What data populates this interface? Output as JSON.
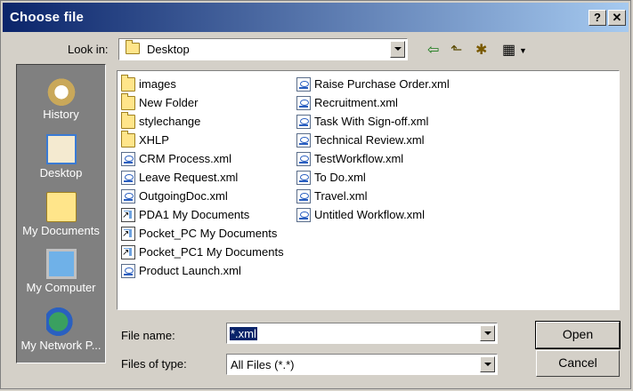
{
  "window": {
    "title": "Choose file",
    "help_label": "?",
    "close_label": "✕"
  },
  "look_in": {
    "label": "Look in:",
    "value": "Desktop"
  },
  "toolbar": {
    "back_glyph": "⇦",
    "up_glyph": "⬑",
    "newfolder_glyph": "✱",
    "view_glyph": "▦"
  },
  "places": [
    {
      "label": "History",
      "icon": "history-icon"
    },
    {
      "label": "Desktop",
      "icon": "desktop-icon"
    },
    {
      "label": "My Documents",
      "icon": "my-documents-icon"
    },
    {
      "label": "My Computer",
      "icon": "my-computer-icon"
    },
    {
      "label": "My Network P...",
      "icon": "my-network-places-icon"
    }
  ],
  "files_col1": [
    {
      "name": "images",
      "type": "folder"
    },
    {
      "name": "New Folder",
      "type": "folder"
    },
    {
      "name": "stylechange",
      "type": "folder"
    },
    {
      "name": "XHLP",
      "type": "folder"
    },
    {
      "name": "CRM Process.xml",
      "type": "xml"
    },
    {
      "name": "Leave Request.xml",
      "type": "xml"
    },
    {
      "name": "OutgoingDoc.xml",
      "type": "xml"
    },
    {
      "name": "PDA1 My Documents",
      "type": "shortcut"
    },
    {
      "name": "Pocket_PC My Documents",
      "type": "shortcut"
    },
    {
      "name": "Pocket_PC1 My Documents",
      "type": "shortcut"
    },
    {
      "name": "Product Launch.xml",
      "type": "xml"
    }
  ],
  "files_col2": [
    {
      "name": "Raise Purchase Order.xml",
      "type": "xml"
    },
    {
      "name": "Recruitment.xml",
      "type": "xml"
    },
    {
      "name": "Task With Sign-off.xml",
      "type": "xml"
    },
    {
      "name": "Technical Review.xml",
      "type": "xml"
    },
    {
      "name": "TestWorkflow.xml",
      "type": "xml"
    },
    {
      "name": "To Do.xml",
      "type": "xml"
    },
    {
      "name": "Travel.xml",
      "type": "xml"
    },
    {
      "name": "Untitled Workflow.xml",
      "type": "xml"
    }
  ],
  "file_name": {
    "label": "File name:",
    "value": "*.xml"
  },
  "files_of_type": {
    "label": "Files of type:",
    "value": "All Files (*.*)"
  },
  "buttons": {
    "open": "Open",
    "cancel": "Cancel"
  }
}
